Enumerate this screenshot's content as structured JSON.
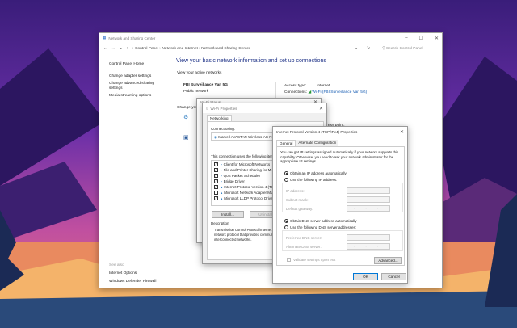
{
  "main": {
    "title": "Network and Sharing Center",
    "breadcrumb": [
      "Control Panel",
      "Network and Internet",
      "Network and Sharing Center"
    ],
    "search_placeholder": "Search Control Panel",
    "sidebar": {
      "items": [
        "Control Panel Home",
        "Change adapter settings",
        "Change advanced sharing settings",
        "Media streaming options"
      ],
      "see_also": "See also",
      "see_also_items": [
        "Internet Options",
        "Windows Defender Firewall"
      ]
    },
    "heading": "View your basic network information and set up connections",
    "active_networks": "View your active networks",
    "network_name": "FBI Surveillance Van 5G",
    "network_type": "Public network",
    "access_type_label": "Access type:",
    "access_type": "Internet",
    "connections_label": "Connections:",
    "connection": "Wi-Fi (FBI Surveillance Van 5G)",
    "change_label": "Change your networking settings",
    "access_point": "ess point."
  },
  "wifi_status": {
    "title": "Wi-Fi Status"
  },
  "wifi_props": {
    "title": "Wi-Fi Properties",
    "tab": "Networking",
    "connect_using": "Connect using:",
    "adapter": "Marvell AVASTAR Wireless-AC N",
    "items_label": "This connection uses the following items:",
    "items": [
      {
        "label": "Client for Microsoft Networks",
        "checked": true
      },
      {
        "label": "File and Printer Sharing for Mi",
        "checked": true
      },
      {
        "label": "QoS Packet Scheduler",
        "checked": true
      },
      {
        "label": "Bridge Driver",
        "checked": true
      },
      {
        "label": "Internet Protocol Version 4 (TC",
        "checked": true
      },
      {
        "label": "Microsoft Network Adapter Mu",
        "checked": false
      },
      {
        "label": "Microsoft LLDP Protocol Drive",
        "checked": true
      }
    ],
    "install": "Install...",
    "uninstall": "Uninstall",
    "description_label": "Description",
    "description": "Transmission Control Protocol/Internet Protocol. The default wide area network protocol that provides communication across diverse interconnected networks."
  },
  "ipv4": {
    "title": "Internet Protocol Version 4 (TCP/IPv4) Properties",
    "tabs": [
      "General",
      "Alternate Configuration"
    ],
    "intro": "You can get IP settings assigned automatically if your network supports this capability. Otherwise, you need to ask your network administrator for the appropriate IP settings.",
    "auto_ip": "Obtain an IP address automatically",
    "manual_ip": "Use the following IP address:",
    "ip_address": "IP address:",
    "subnet": "Subnet mask:",
    "gateway": "Default gateway:",
    "auto_dns": "Obtain DNS server address automatically",
    "manual_dns": "Use the following DNS server addresses:",
    "preferred_dns": "Preferred DNS server:",
    "alternate_dns": "Alternate DNS server:",
    "validate": "Validate settings upon exit",
    "advanced": "Advanced...",
    "ok": "OK",
    "cancel": "Cancel",
    "ip_placeholder": ". . ."
  }
}
